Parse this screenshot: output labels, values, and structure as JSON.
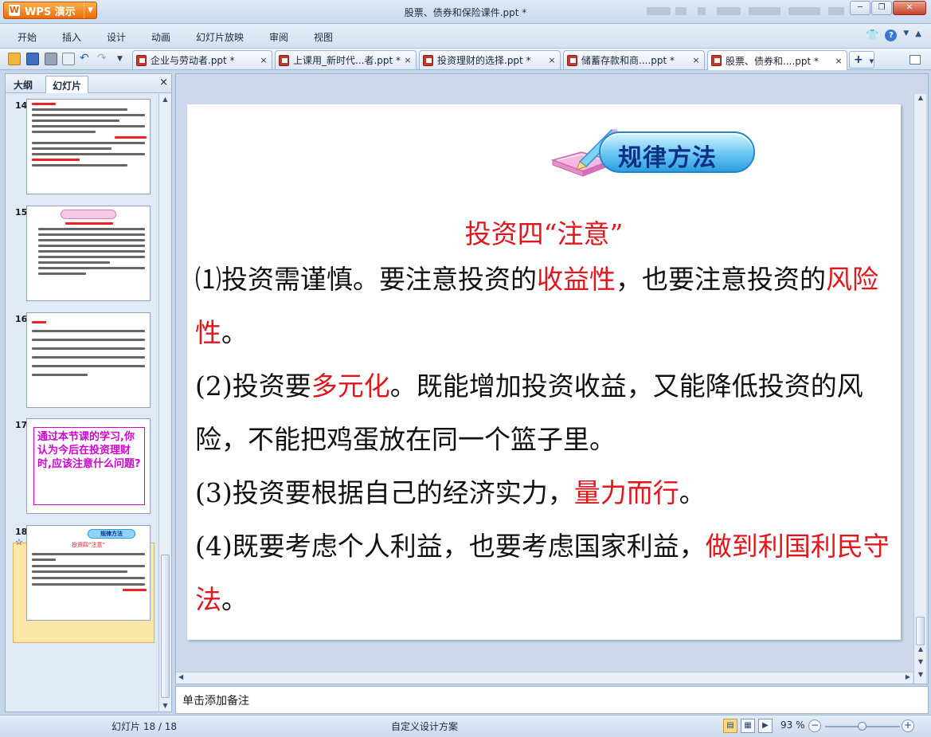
{
  "app": {
    "name": "WPS 演示",
    "logo": "W"
  },
  "window": {
    "title": "股票、债券和保险课件.ppt *"
  },
  "menu": [
    "开始",
    "插入",
    "设计",
    "动画",
    "幻灯片放映",
    "审阅",
    "视图"
  ],
  "doc_tabs": [
    {
      "label": "企业与劳动者.ppt *",
      "active": false
    },
    {
      "label": "上课用_新时代...者.ppt *",
      "active": false
    },
    {
      "label": "投资理财的选择.ppt *",
      "active": false
    },
    {
      "label": "储蓄存款和商....ppt *",
      "active": false
    },
    {
      "label": "股票、债券和....ppt *",
      "active": true
    }
  ],
  "new_tab_label": "+",
  "left_panel": {
    "tabs": [
      "大纲",
      "幻灯片"
    ],
    "active_tab": "幻灯片",
    "close_label": "×",
    "thumbnails": [
      {
        "number": "14"
      },
      {
        "number": "15"
      },
      {
        "number": "16"
      },
      {
        "number": "17",
        "text": "通过本节课的学习,你认为今后在投资理财时,应该注意什么问题?"
      },
      {
        "number": "18",
        "star": "☆",
        "selected": true,
        "badge_text": "规律方法",
        "heading": "投资四“注意”"
      }
    ]
  },
  "slide": {
    "badge_text": "规律方法",
    "heading": "投资四“注意”",
    "paragraphs": [
      {
        "prefix": "⑴投资需谨慎。要注意投资的",
        "highlight": "收益性",
        "mid": "，也要注意投资的",
        "highlight2": "风险性",
        "suffix": "。"
      },
      {
        "prefix": "(2)投资要",
        "highlight": "多元化",
        "suffix": "。既能增加投资收益，又能降低投资的风险，不能把鸡蛋放在同一个篮子里。"
      },
      {
        "prefix": "(3)投资要根据自己的经济实力，",
        "highlight": "量力而行",
        "suffix": "。"
      },
      {
        "prefix": "(4)既要考虑个人利益，也要考虑国家利益，",
        "highlight": "做到利国利民守法",
        "suffix": "。"
      }
    ]
  },
  "notes_placeholder": "单击添加备注",
  "status": {
    "slide_counter": "幻灯片 18 / 18",
    "design_scheme": "自定义设计方案",
    "zoom": "93 %",
    "zoom_level": 0.5
  },
  "colors": {
    "accent_red": "#e0161c",
    "thumb17_magenta": "#d000d0",
    "wps_orange": "#e86a0a"
  }
}
